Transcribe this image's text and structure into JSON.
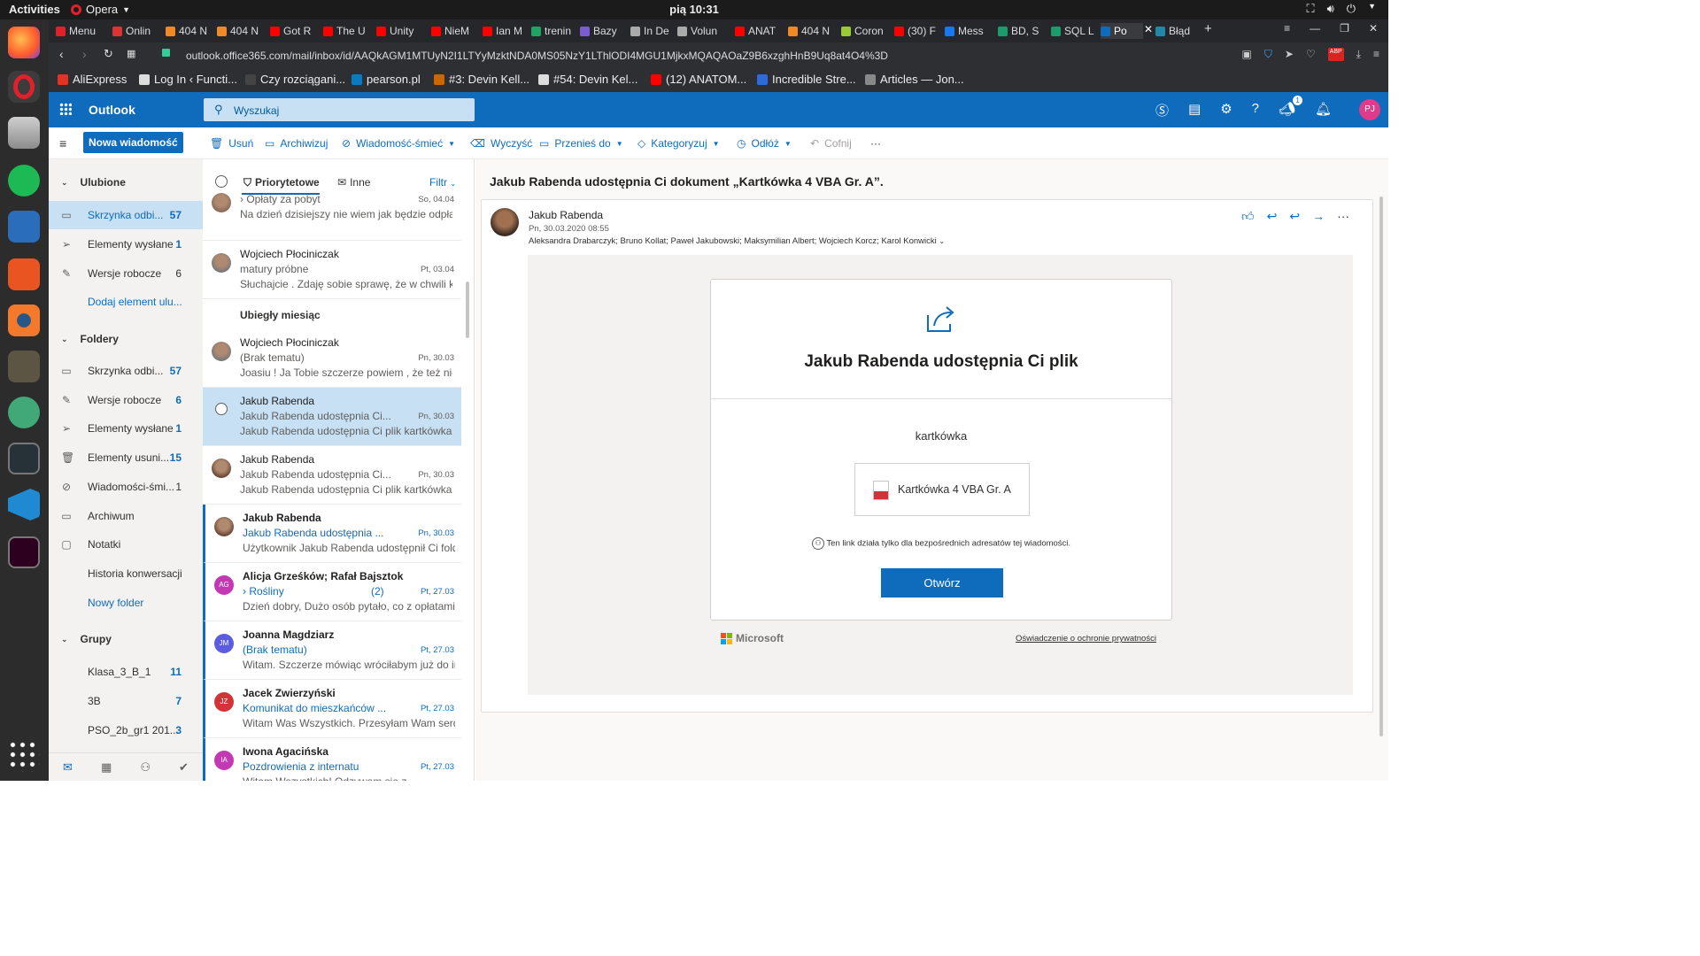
{
  "system": {
    "activities": "Activities",
    "app": "Opera",
    "clock": "pią 10:31"
  },
  "tabs": [
    {
      "label": "Menu",
      "color": "#e0202b"
    },
    {
      "label": "Onlin",
      "color": "#d33"
    },
    {
      "label": "404 N",
      "color": "#f08a24"
    },
    {
      "label": "404 N",
      "color": "#f08a24"
    },
    {
      "label": "Got R",
      "color": "#f00"
    },
    {
      "label": "The U",
      "color": "#f00"
    },
    {
      "label": "Unity",
      "color": "#f00"
    },
    {
      "label": "NieM",
      "color": "#f00"
    },
    {
      "label": "Ian M",
      "color": "#f00"
    },
    {
      "label": "trenin",
      "color": "#1fa463"
    },
    {
      "label": "Bazy",
      "color": "#7a5cd3"
    },
    {
      "label": "In De",
      "color": "#aaa"
    },
    {
      "label": "Volun",
      "color": "#aaa"
    },
    {
      "label": "ANAT",
      "color": "#f00"
    },
    {
      "label": "404 N",
      "color": "#f08a24"
    },
    {
      "label": "Coron",
      "color": "#9c3"
    },
    {
      "label": "(30) F",
      "color": "#f00"
    },
    {
      "label": "Mess",
      "color": "#1877f2"
    },
    {
      "label": "BD, S",
      "color": "#1a9c6c"
    },
    {
      "label": "SQL L",
      "color": "#1a9c6c"
    },
    {
      "label": "Po",
      "color": "#0f6cbd"
    },
    {
      "label": "Błąd",
      "color": "#28a"
    }
  ],
  "address": {
    "url": "outlook.office365.com/mail/inbox/id/AAQkAGM1MTUyN2I1LTYyMzktNDA0MS05NzY1LThlODI4MGU1MjkxMQAQAOaZ9B6xzghHnB9Uq8at4O4%3D"
  },
  "bookmarks": [
    {
      "label": "AliExpress",
      "color": "#e43225"
    },
    {
      "label": "Log In ‹ Functi...",
      "color": "#ddd"
    },
    {
      "label": "Czy rozciągani...",
      "color": "#444"
    },
    {
      "label": "pearson.pl",
      "color": "#0a7bc1"
    },
    {
      "label": "#3: Devin Kell...",
      "color": "#c60"
    },
    {
      "label": "#54: Devin Kel...",
      "color": "#ddd"
    },
    {
      "label": "(12) ANATOM...",
      "color": "#f00"
    },
    {
      "label": "Incredible Stre...",
      "color": "#2b6cd8"
    },
    {
      "label": "Articles — Jon...",
      "color": "#888"
    }
  ],
  "outlook": {
    "app_name": "Outlook",
    "search_placeholder": "Wyszukaj",
    "avatar": "PJ",
    "badge": "1",
    "new_message": "Nowa wiadomość",
    "commands": {
      "delete": "Usuń",
      "archive": "Archiwizuj",
      "junk": "Wiadomość-śmieć",
      "sweep": "Wyczyść",
      "move": "Przenieś do",
      "categorize": "Kategoryzuj",
      "snooze": "Odłóż",
      "undo": "Cofnij"
    }
  },
  "nav": {
    "favorites": "Ulubione",
    "fav_items": [
      {
        "label": "Skrzynka odbi...",
        "count": "57"
      },
      {
        "label": "Elementy wysłane",
        "count": "1"
      },
      {
        "label": "Wersje robocze",
        "count": "6"
      }
    ],
    "add_favorite": "Dodaj element ulu...",
    "folders": "Foldery",
    "folder_items": [
      {
        "label": "Skrzynka odbi...",
        "count": "57"
      },
      {
        "label": "Wersje robocze",
        "count": "6"
      },
      {
        "label": "Elementy wysłane",
        "count": "1"
      },
      {
        "label": "Elementy usuni...",
        "count": "15"
      },
      {
        "label": "Wiadomości-śmi...",
        "count": "1"
      },
      {
        "label": "Archiwum",
        "count": ""
      },
      {
        "label": "Notatki",
        "count": ""
      },
      {
        "label": "Historia konwersacji",
        "count": ""
      }
    ],
    "new_folder": "Nowy folder",
    "groups": "Grupy",
    "group_items": [
      {
        "label": "Klasa_3_B_1",
        "count": "11"
      },
      {
        "label": "3B",
        "count": "7"
      },
      {
        "label": "PSO_2b_gr1 201...",
        "count": "3"
      }
    ]
  },
  "list": {
    "tab_focused": "Priorytetowe",
    "tab_other": "Inne",
    "filter": "Filtr",
    "group_last_month": "Ubiegły miesiąc",
    "messages": [
      {
        "from": "",
        "subject": "Opłaty za pobyt",
        "date": "So, 04.04",
        "preview": "Na dzień dzisiejszy nie wiem jak będzie odpłatn",
        "avatar": "",
        "color": "#8a6d5a"
      },
      {
        "from": "Wojciech Płociniczak",
        "subject": "matury próbne",
        "date": "Pt, 03.04",
        "preview": "Słuchajcie . Zdaję sobie sprawę, że w chwili kied",
        "avatar": "",
        "color": "#7a7a7a"
      },
      {
        "from": "Wojciech Płociniczak",
        "subject": "(Brak tematu)",
        "date": "Pn, 30.03",
        "preview": "Joasiu ! Ja Tobie szczerze powiem , że też nie m",
        "avatar": "",
        "color": "#7a7a7a"
      },
      {
        "from": "Jakub Rabenda",
        "subject": "Jakub Rabenda udostępnia Ci...",
        "date": "Pn, 30.03",
        "preview": "Jakub Rabenda udostępnia Ci plik kartkówka Ka",
        "avatar": "",
        "color": "#6b4a36"
      },
      {
        "from": "Jakub Rabenda",
        "subject": "Jakub Rabenda udostępnia Ci...",
        "date": "Pn, 30.03",
        "preview": "Jakub Rabenda udostępnia Ci plik kartkówka Ka",
        "avatar": "",
        "color": "#6b4a36"
      },
      {
        "from": "Jakub Rabenda",
        "subject": "Jakub Rabenda udostępnia ...",
        "date": "Pn, 30.03",
        "preview": "Użytkownik Jakub Rabenda udostępnił Ci folde",
        "avatar": "",
        "color": "#6b4a36"
      },
      {
        "from": "Alicja Grześków; Rafał Bajsztok",
        "subject": "Rośliny",
        "count": "(2)",
        "date": "Pt, 27.03",
        "preview": "Dzień dobry, Dużo osób pytało, co z opłatami z",
        "avatar": "AG",
        "color": "#c239b3"
      },
      {
        "from": "Joanna Magdziarz",
        "subject": "(Brak tematu)",
        "date": "Pt, 27.03",
        "preview": "Witam. Szczerze mówiąc wróciłabym już do inte",
        "avatar": "JM",
        "color": "#5c5ce0"
      },
      {
        "from": "Jacek Zwierzyński",
        "subject": "Komunikat do mieszkańców ...",
        "date": "Pt, 27.03",
        "preview": "Witam Was Wszystkich. Przesyłam Wam serdec",
        "avatar": "JZ",
        "color": "#d13438"
      },
      {
        "from": "Iwona Agacińska",
        "subject": "Pozdrowienia z internatu",
        "date": "Pt, 27.03",
        "preview": "Witam Wszystkich! Odzywam się z",
        "avatar": "IA",
        "color": "#c239b3"
      }
    ]
  },
  "reading": {
    "subject": "Jakub Rabenda udostępnia Ci dokument „Kartkówka 4 VBA Gr. A”.",
    "sender": "Jakub Rabenda",
    "datetime": "Pn, 30.03.2020 08:55",
    "recipients": "Aleksandra Drabarczyk; Bruno Kollat; Paweł Jakubowski; Maksymilian Albert; Wojciech Korcz; Karol Konwicki",
    "card_title": "Jakub Rabenda udostępnia Ci plik",
    "card_message": "kartkówka",
    "file_name": "Kartkówka 4 VBA Gr. A",
    "link_note": "Ten link działa tylko dla bezpośrednich adresatów tej wiadomości.",
    "open_button": "Otwórz",
    "ms_logo_text": "Microsoft",
    "privacy": "Oświadczenie o ochronie prywatności"
  }
}
